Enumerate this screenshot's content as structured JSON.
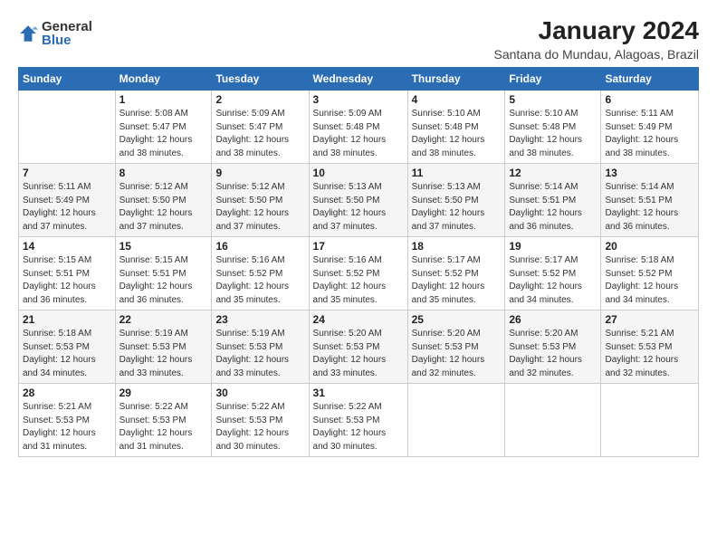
{
  "logo": {
    "general": "General",
    "blue": "Blue"
  },
  "title": "January 2024",
  "subtitle": "Santana do Mundau, Alagoas, Brazil",
  "headers": [
    "Sunday",
    "Monday",
    "Tuesday",
    "Wednesday",
    "Thursday",
    "Friday",
    "Saturday"
  ],
  "weeks": [
    [
      {
        "day": "",
        "detail": ""
      },
      {
        "day": "1",
        "detail": "Sunrise: 5:08 AM\nSunset: 5:47 PM\nDaylight: 12 hours\nand 38 minutes."
      },
      {
        "day": "2",
        "detail": "Sunrise: 5:09 AM\nSunset: 5:47 PM\nDaylight: 12 hours\nand 38 minutes."
      },
      {
        "day": "3",
        "detail": "Sunrise: 5:09 AM\nSunset: 5:48 PM\nDaylight: 12 hours\nand 38 minutes."
      },
      {
        "day": "4",
        "detail": "Sunrise: 5:10 AM\nSunset: 5:48 PM\nDaylight: 12 hours\nand 38 minutes."
      },
      {
        "day": "5",
        "detail": "Sunrise: 5:10 AM\nSunset: 5:48 PM\nDaylight: 12 hours\nand 38 minutes."
      },
      {
        "day": "6",
        "detail": "Sunrise: 5:11 AM\nSunset: 5:49 PM\nDaylight: 12 hours\nand 38 minutes."
      }
    ],
    [
      {
        "day": "7",
        "detail": "Sunrise: 5:11 AM\nSunset: 5:49 PM\nDaylight: 12 hours\nand 37 minutes."
      },
      {
        "day": "8",
        "detail": "Sunrise: 5:12 AM\nSunset: 5:50 PM\nDaylight: 12 hours\nand 37 minutes."
      },
      {
        "day": "9",
        "detail": "Sunrise: 5:12 AM\nSunset: 5:50 PM\nDaylight: 12 hours\nand 37 minutes."
      },
      {
        "day": "10",
        "detail": "Sunrise: 5:13 AM\nSunset: 5:50 PM\nDaylight: 12 hours\nand 37 minutes."
      },
      {
        "day": "11",
        "detail": "Sunrise: 5:13 AM\nSunset: 5:50 PM\nDaylight: 12 hours\nand 37 minutes."
      },
      {
        "day": "12",
        "detail": "Sunrise: 5:14 AM\nSunset: 5:51 PM\nDaylight: 12 hours\nand 36 minutes."
      },
      {
        "day": "13",
        "detail": "Sunrise: 5:14 AM\nSunset: 5:51 PM\nDaylight: 12 hours\nand 36 minutes."
      }
    ],
    [
      {
        "day": "14",
        "detail": "Sunrise: 5:15 AM\nSunset: 5:51 PM\nDaylight: 12 hours\nand 36 minutes."
      },
      {
        "day": "15",
        "detail": "Sunrise: 5:15 AM\nSunset: 5:51 PM\nDaylight: 12 hours\nand 36 minutes."
      },
      {
        "day": "16",
        "detail": "Sunrise: 5:16 AM\nSunset: 5:52 PM\nDaylight: 12 hours\nand 35 minutes."
      },
      {
        "day": "17",
        "detail": "Sunrise: 5:16 AM\nSunset: 5:52 PM\nDaylight: 12 hours\nand 35 minutes."
      },
      {
        "day": "18",
        "detail": "Sunrise: 5:17 AM\nSunset: 5:52 PM\nDaylight: 12 hours\nand 35 minutes."
      },
      {
        "day": "19",
        "detail": "Sunrise: 5:17 AM\nSunset: 5:52 PM\nDaylight: 12 hours\nand 34 minutes."
      },
      {
        "day": "20",
        "detail": "Sunrise: 5:18 AM\nSunset: 5:52 PM\nDaylight: 12 hours\nand 34 minutes."
      }
    ],
    [
      {
        "day": "21",
        "detail": "Sunrise: 5:18 AM\nSunset: 5:53 PM\nDaylight: 12 hours\nand 34 minutes."
      },
      {
        "day": "22",
        "detail": "Sunrise: 5:19 AM\nSunset: 5:53 PM\nDaylight: 12 hours\nand 33 minutes."
      },
      {
        "day": "23",
        "detail": "Sunrise: 5:19 AM\nSunset: 5:53 PM\nDaylight: 12 hours\nand 33 minutes."
      },
      {
        "day": "24",
        "detail": "Sunrise: 5:20 AM\nSunset: 5:53 PM\nDaylight: 12 hours\nand 33 minutes."
      },
      {
        "day": "25",
        "detail": "Sunrise: 5:20 AM\nSunset: 5:53 PM\nDaylight: 12 hours\nand 32 minutes."
      },
      {
        "day": "26",
        "detail": "Sunrise: 5:20 AM\nSunset: 5:53 PM\nDaylight: 12 hours\nand 32 minutes."
      },
      {
        "day": "27",
        "detail": "Sunrise: 5:21 AM\nSunset: 5:53 PM\nDaylight: 12 hours\nand 32 minutes."
      }
    ],
    [
      {
        "day": "28",
        "detail": "Sunrise: 5:21 AM\nSunset: 5:53 PM\nDaylight: 12 hours\nand 31 minutes."
      },
      {
        "day": "29",
        "detail": "Sunrise: 5:22 AM\nSunset: 5:53 PM\nDaylight: 12 hours\nand 31 minutes."
      },
      {
        "day": "30",
        "detail": "Sunrise: 5:22 AM\nSunset: 5:53 PM\nDaylight: 12 hours\nand 30 minutes."
      },
      {
        "day": "31",
        "detail": "Sunrise: 5:22 AM\nSunset: 5:53 PM\nDaylight: 12 hours\nand 30 minutes."
      },
      {
        "day": "",
        "detail": ""
      },
      {
        "day": "",
        "detail": ""
      },
      {
        "day": "",
        "detail": ""
      }
    ]
  ]
}
